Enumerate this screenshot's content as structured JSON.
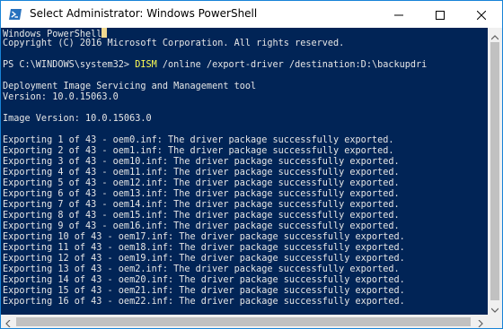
{
  "window": {
    "title": "Select Administrator: Windows PowerShell",
    "icon": "powershell-icon",
    "controls": [
      "minimize-icon",
      "maximize-icon",
      "close-icon"
    ]
  },
  "console": {
    "header_line": "Windows PowerShell",
    "copyright": "Copyright (C) 2016 Microsoft Corporation. All rights reserved.",
    "prompt": "PS C:\\WINDOWS\\system32> ",
    "command_name": "DISM",
    "command_args": " /online /export-driver /destination:D:\\backupdri",
    "tool_name": "Deployment Image Servicing and Management tool",
    "tool_version": "Version: 10.0.15063.0",
    "image_version": "Image Version: 10.0.15063.0",
    "export_lines": [
      "Exporting 1 of 43 - oem0.inf: The driver package successfully exported.",
      "Exporting 2 of 43 - oem1.inf: The driver package successfully exported.",
      "Exporting 3 of 43 - oem10.inf: The driver package successfully exported.",
      "Exporting 4 of 43 - oem11.inf: The driver package successfully exported.",
      "Exporting 5 of 43 - oem12.inf: The driver package successfully exported.",
      "Exporting 6 of 43 - oem13.inf: The driver package successfully exported.",
      "Exporting 7 of 43 - oem14.inf: The driver package successfully exported.",
      "Exporting 8 of 43 - oem15.inf: The driver package successfully exported.",
      "Exporting 9 of 43 - oem16.inf: The driver package successfully exported.",
      "Exporting 10 of 43 - oem17.inf: The driver package successfully exported.",
      "Exporting 11 of 43 - oem18.inf: The driver package successfully exported.",
      "Exporting 12 of 43 - oem19.inf: The driver package successfully exported.",
      "Exporting 13 of 43 - oem2.inf: The driver package successfully exported.",
      "Exporting 14 of 43 - oem20.inf: The driver package successfully exported.",
      "Exporting 15 of 43 - oem21.inf: The driver package successfully exported.",
      "Exporting 16 of 43 - oem22.inf: The driver package successfully exported."
    ]
  },
  "colors": {
    "console_background": "#012456",
    "console_text": "#e6e6e6",
    "command_highlight": "#fefe54",
    "window_border": "#1883d7"
  }
}
